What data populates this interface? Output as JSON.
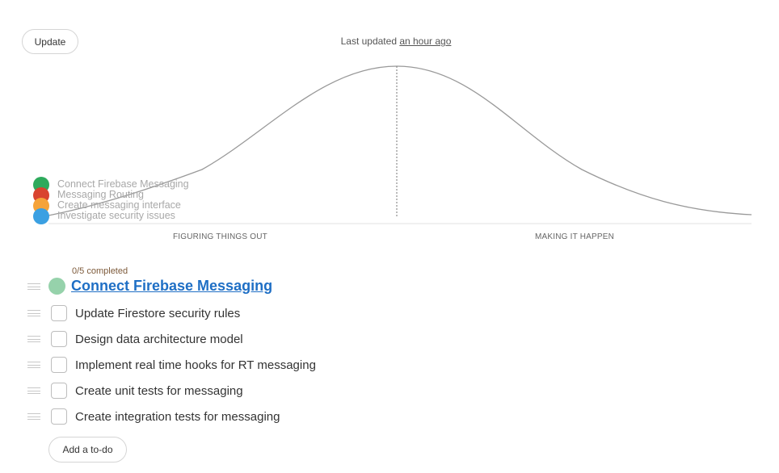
{
  "header": {
    "update_label": "Update",
    "last_updated_prefix": "Last updated ",
    "last_updated_relative": "an hour ago"
  },
  "hill": {
    "left_phase": "FIGURING THINGS OUT",
    "right_phase": "MAKING IT HAPPEN",
    "curve_color": "#999999",
    "scopes": [
      {
        "label": "Connect Firebase Messaging",
        "color": "#2eaa5c"
      },
      {
        "label": "Messaging Routing",
        "color": "#d9432f"
      },
      {
        "label": "Create messaging interface",
        "color": "#f5a33a"
      },
      {
        "label": "Investigate security issues",
        "color": "#3ba0e2"
      }
    ]
  },
  "scope": {
    "progress": "0/5 completed",
    "title": "Connect Firebase Messaging",
    "dot_color": "#96d2ab",
    "link_color": "#1f6fc5"
  },
  "todos": [
    {
      "label": "Update Firestore security rules",
      "checked": false
    },
    {
      "label": "Design data architecture model",
      "checked": false
    },
    {
      "label": "Implement real time hooks for RT messaging",
      "checked": false
    },
    {
      "label": "Create unit tests for messaging",
      "checked": false
    },
    {
      "label": "Create integration tests for messaging",
      "checked": false
    }
  ],
  "add_todo_label": "Add a to-do"
}
